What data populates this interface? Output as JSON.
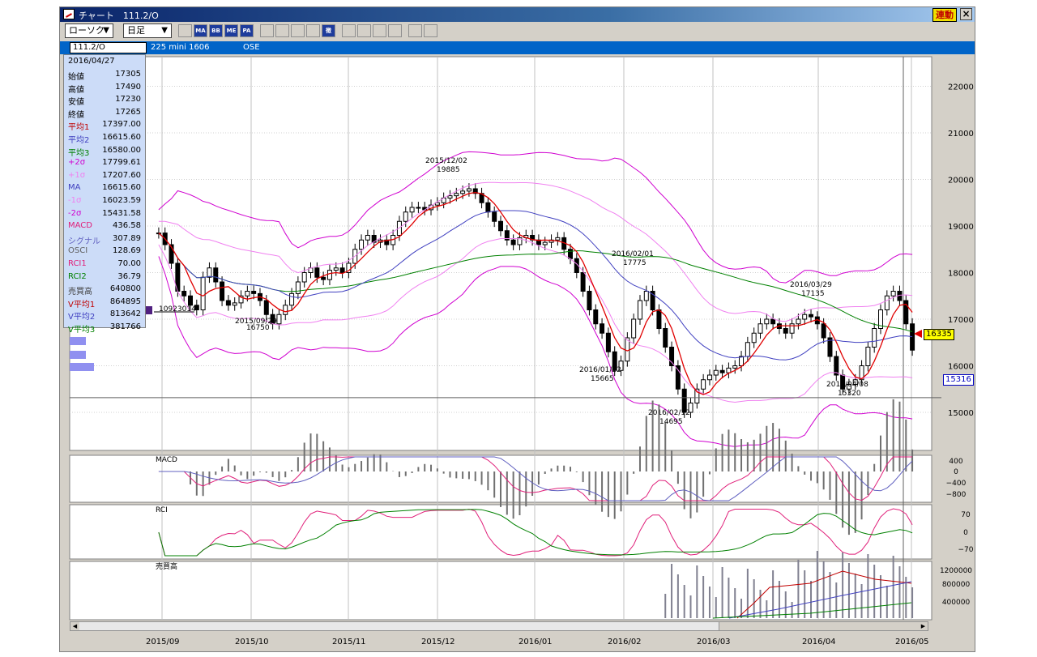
{
  "window": {
    "title": "チャート　111.2/O",
    "link_button": "連動",
    "close": "×"
  },
  "toolbar": {
    "chart_type": "ローソク",
    "period": "日足",
    "buttons": [
      {
        "name": "bar-chart-icon",
        "label": ""
      },
      {
        "name": "ma-button",
        "label": "MA"
      },
      {
        "name": "bb-button",
        "label": "BB"
      },
      {
        "name": "me-button",
        "label": "ME"
      },
      {
        "name": "pa-button",
        "label": "PA"
      },
      {
        "name": "line-icon",
        "label": ""
      },
      {
        "name": "fibonacci-icon",
        "label": ""
      },
      {
        "name": "crosshair-icon",
        "label": ""
      },
      {
        "name": "zoom-icon",
        "label": ""
      },
      {
        "name": "calculate-icon",
        "label": "徴"
      },
      {
        "name": "period-icon",
        "label": ""
      },
      {
        "name": "pen-icon",
        "label": ""
      },
      {
        "name": "cursor-icon",
        "label": ""
      },
      {
        "name": "eraser-icon",
        "label": ""
      },
      {
        "name": "settings-icon",
        "label": ""
      },
      {
        "name": "flag-icon",
        "label": ""
      }
    ]
  },
  "infobar": {
    "code": "111.2/O",
    "name": "225 mini 1606",
    "market": "OSE"
  },
  "datapanel": {
    "date": "2016/04/27",
    "rows": [
      {
        "label": "始値",
        "value": "17305",
        "color": "#000000"
      },
      {
        "label": "高値",
        "value": "17490",
        "color": "#000000"
      },
      {
        "label": "安値",
        "value": "17230",
        "color": "#000000"
      },
      {
        "label": "終値",
        "value": "17265",
        "color": "#000000"
      },
      {
        "label": "平均1",
        "value": "17397.00",
        "color": "#c00000"
      },
      {
        "label": "平均2",
        "value": "16615.60",
        "color": "#4040c0"
      },
      {
        "label": "平均3",
        "value": "16580.00",
        "color": "#008000"
      },
      {
        "label": "+2σ",
        "value": "17799.61",
        "color": "#d000d0"
      },
      {
        "label": "+1σ",
        "value": "17207.60",
        "color": "#f080f0"
      },
      {
        "label": "MA",
        "value": "16615.60",
        "color": "#4040c0"
      },
      {
        "label": "-1σ",
        "value": "16023.59",
        "color": "#f080f0"
      },
      {
        "label": "-2σ",
        "value": "15431.58",
        "color": "#d000d0"
      },
      {
        "label": "MACD",
        "value": "436.58",
        "color": "#e0207a"
      },
      {
        "label": "シグナル",
        "value": "307.89",
        "color": "#6060c0"
      },
      {
        "label": "OSCI",
        "value": "128.69",
        "color": "#606060"
      },
      {
        "label": "RCI1",
        "value": "70.00",
        "color": "#e0207a"
      },
      {
        "label": "RCI2",
        "value": "36.79",
        "color": "#008000"
      },
      {
        "label": "売買高",
        "value": "640800",
        "color": "#404040"
      },
      {
        "label": "V平均1",
        "value": "864895",
        "color": "#c00000"
      },
      {
        "label": "V平均2",
        "value": "813642",
        "color": "#4040c0"
      },
      {
        "label": "V平均3",
        "value": "381766",
        "color": "#008000"
      }
    ]
  },
  "chart_data": {
    "type": "candlestick",
    "x_labels": [
      "2015/09",
      "2015/10",
      "2015/11",
      "2015/12",
      "2016/01",
      "2016/02",
      "2016/03",
      "2016/04",
      "2016/05"
    ],
    "price_axis": {
      "ticks": [
        22000,
        21000,
        20000,
        19000,
        18000,
        17000,
        16000,
        15000
      ],
      "ylim": [
        14200,
        22600
      ]
    },
    "last_price": "16335",
    "line_price": "15316",
    "annotations": [
      {
        "date": "2015/09/29",
        "price": "16750"
      },
      {
        "date": "2015/12/02",
        "price": "19885"
      },
      {
        "date": "2016/01/22",
        "price": "15665"
      },
      {
        "date": "2016/02/01",
        "price": "17775"
      },
      {
        "date": "2016/02/12",
        "price": "14695"
      },
      {
        "date": "2016/03/29",
        "price": "17135"
      },
      {
        "date": "2016/04/08",
        "price": "15320"
      }
    ],
    "left_marker": "10923014",
    "close_series": [
      18850,
      18600,
      18200,
      17600,
      17500,
      17300,
      17200,
      17900,
      18100,
      17800,
      17400,
      17300,
      17350,
      17500,
      17600,
      17550,
      17400,
      17100,
      16900,
      17100,
      17300,
      17550,
      17800,
      18000,
      18100,
      17900,
      17850,
      18050,
      18100,
      18000,
      18200,
      18500,
      18700,
      18800,
      18650,
      18700,
      18600,
      18800,
      19100,
      19300,
      19400,
      19400,
      19350,
      19450,
      19500,
      19600,
      19650,
      19700,
      19750,
      19800,
      19700,
      19500,
      19300,
      19100,
      18900,
      18700,
      18600,
      18750,
      18800,
      18700,
      18600,
      18650,
      18700,
      18750,
      18500,
      18300,
      18000,
      17600,
      17200,
      16900,
      16700,
      16300,
      15900,
      16100,
      16600,
      17000,
      17400,
      17600,
      17200,
      16800,
      16400,
      16000,
      15500,
      15000,
      15200,
      15500,
      15700,
      15800,
      15900,
      15850,
      15950,
      16000,
      16200,
      16500,
      16700,
      16900,
      17000,
      16900,
      16800,
      16700,
      16900,
      17000,
      17100,
      17050,
      16900,
      16600,
      16200,
      15800,
      15500,
      15600,
      15700,
      16000,
      16400,
      16800,
      17200,
      17500,
      17600,
      17400,
      16900,
      16335
    ],
    "macd_panel": {
      "label": "MACD",
      "ticks": [
        "400",
        "0",
        "−400",
        "−800"
      ]
    },
    "rci_panel": {
      "label": "RCI",
      "ticks": [
        "70",
        "0",
        "−70"
      ]
    },
    "volume_panel": {
      "label": "売買高",
      "ticks": [
        "1200000",
        "800000",
        "400000"
      ]
    }
  }
}
